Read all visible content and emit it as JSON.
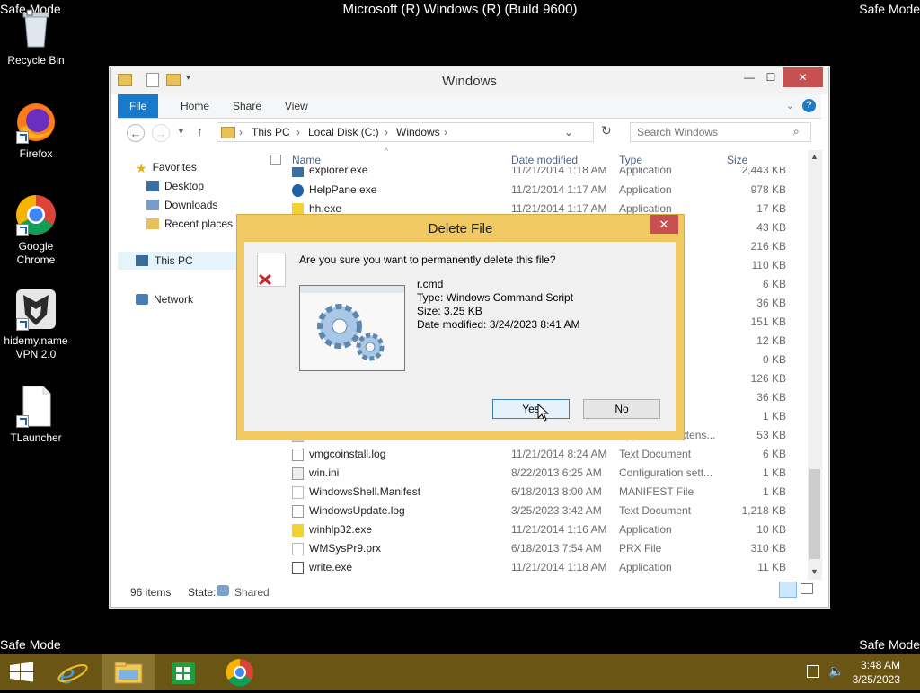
{
  "screen": {
    "watermark_top_center": "Microsoft (R) Windows (R) (Build 9600)",
    "safe_mode_label": "Safe Mode"
  },
  "desktop": {
    "icons": [
      {
        "label": "Recycle Bin",
        "icon": "recycle-bin-icon"
      },
      {
        "label": "Firefox",
        "icon": "firefox-icon"
      },
      {
        "label": "Google\nChrome",
        "label_line1": "Google",
        "label_line2": "Chrome",
        "icon": "chrome-icon"
      },
      {
        "label_line1": "hidemy.name",
        "label_line2": "VPN 2.0",
        "icon": "vpn-icon"
      },
      {
        "label": "TLauncher",
        "icon": "file-icon"
      }
    ]
  },
  "explorer": {
    "title": "Windows",
    "ribbon_tabs": [
      "File",
      "Home",
      "Share",
      "View"
    ],
    "address": {
      "segments": [
        "This PC",
        "Local Disk (C:)",
        "Windows"
      ]
    },
    "search_placeholder": "Search Windows",
    "nav": {
      "favorites": "Favorites",
      "desktop": "Desktop",
      "downloads": "Downloads",
      "recent": "Recent places",
      "this_pc": "This PC",
      "network": "Network"
    },
    "columns": {
      "name": "Name",
      "date": "Date modified",
      "type": "Type",
      "size": "Size"
    },
    "files": [
      {
        "name": "explorer.exe",
        "date": "11/21/2014 1:18 AM",
        "type": "Application",
        "size": "2,443 KB"
      },
      {
        "name": "HelpPane.exe",
        "date": "11/21/2014 1:17 AM",
        "type": "Application",
        "size": "978 KB"
      },
      {
        "name": "hh.exe",
        "date": "11/21/2014 1:17 AM",
        "type": "Application",
        "size": "17 KB"
      },
      {
        "size": "43 KB"
      },
      {
        "size": "216 KB"
      },
      {
        "size": "110 KB"
      },
      {
        "type": "nt",
        "size": "6 KB"
      },
      {
        "size": "36 KB"
      },
      {
        "size": "151 KB"
      },
      {
        "type": "nt",
        "size": "12 KB"
      },
      {
        "type": "nt",
        "size": "0 KB"
      },
      {
        "size": "126 KB"
      },
      {
        "size": "36 KB"
      },
      {
        "type": "n sett...",
        "size": "1 KB"
      },
      {
        "name": "",
        "type": "Application extens...",
        "size": "53 KB"
      },
      {
        "name": "vmgcoinstall.log",
        "date": "11/21/2014 8:24 AM",
        "type": "Text Document",
        "size": "6 KB"
      },
      {
        "name": "win.ini",
        "date": "8/22/2013 6:25 AM",
        "type": "Configuration sett...",
        "size": "1 KB"
      },
      {
        "name": "WindowsShell.Manifest",
        "date": "6/18/2013 8:00 AM",
        "type": "MANIFEST File",
        "size": "1 KB"
      },
      {
        "name": "WindowsUpdate.log",
        "date": "3/25/2023 3:42 AM",
        "type": "Text Document",
        "size": "1,218 KB"
      },
      {
        "name": "winhlp32.exe",
        "date": "11/21/2014 1:16 AM",
        "type": "Application",
        "size": "10 KB"
      },
      {
        "name": "WMSysPr9.prx",
        "date": "6/18/2013 7:54 AM",
        "type": "PRX File",
        "size": "310 KB"
      },
      {
        "name": "write.exe",
        "date": "11/21/2014 1:18 AM",
        "type": "Application",
        "size": "11 KB"
      }
    ],
    "status": {
      "count": "96 items",
      "state_label": "State:",
      "state_value": "Shared"
    }
  },
  "dialog": {
    "title": "Delete File",
    "question": "Are you sure you want to permanently delete this file?",
    "file_name": "r.cmd",
    "file_type": "Type: Windows Command Script",
    "file_size": "Size: 3.25 KB",
    "file_modified": "Date modified: 3/24/2023 8:41 AM",
    "yes_label": "Yes",
    "no_label": "No"
  },
  "taskbar": {
    "time": "3:48 AM",
    "date": "3/25/2023"
  },
  "colors": {
    "taskbar": "#6b5515",
    "dialog_frame": "#f1c962",
    "ribbon_file_tab": "#1979ca",
    "close_button": "#c75050"
  }
}
